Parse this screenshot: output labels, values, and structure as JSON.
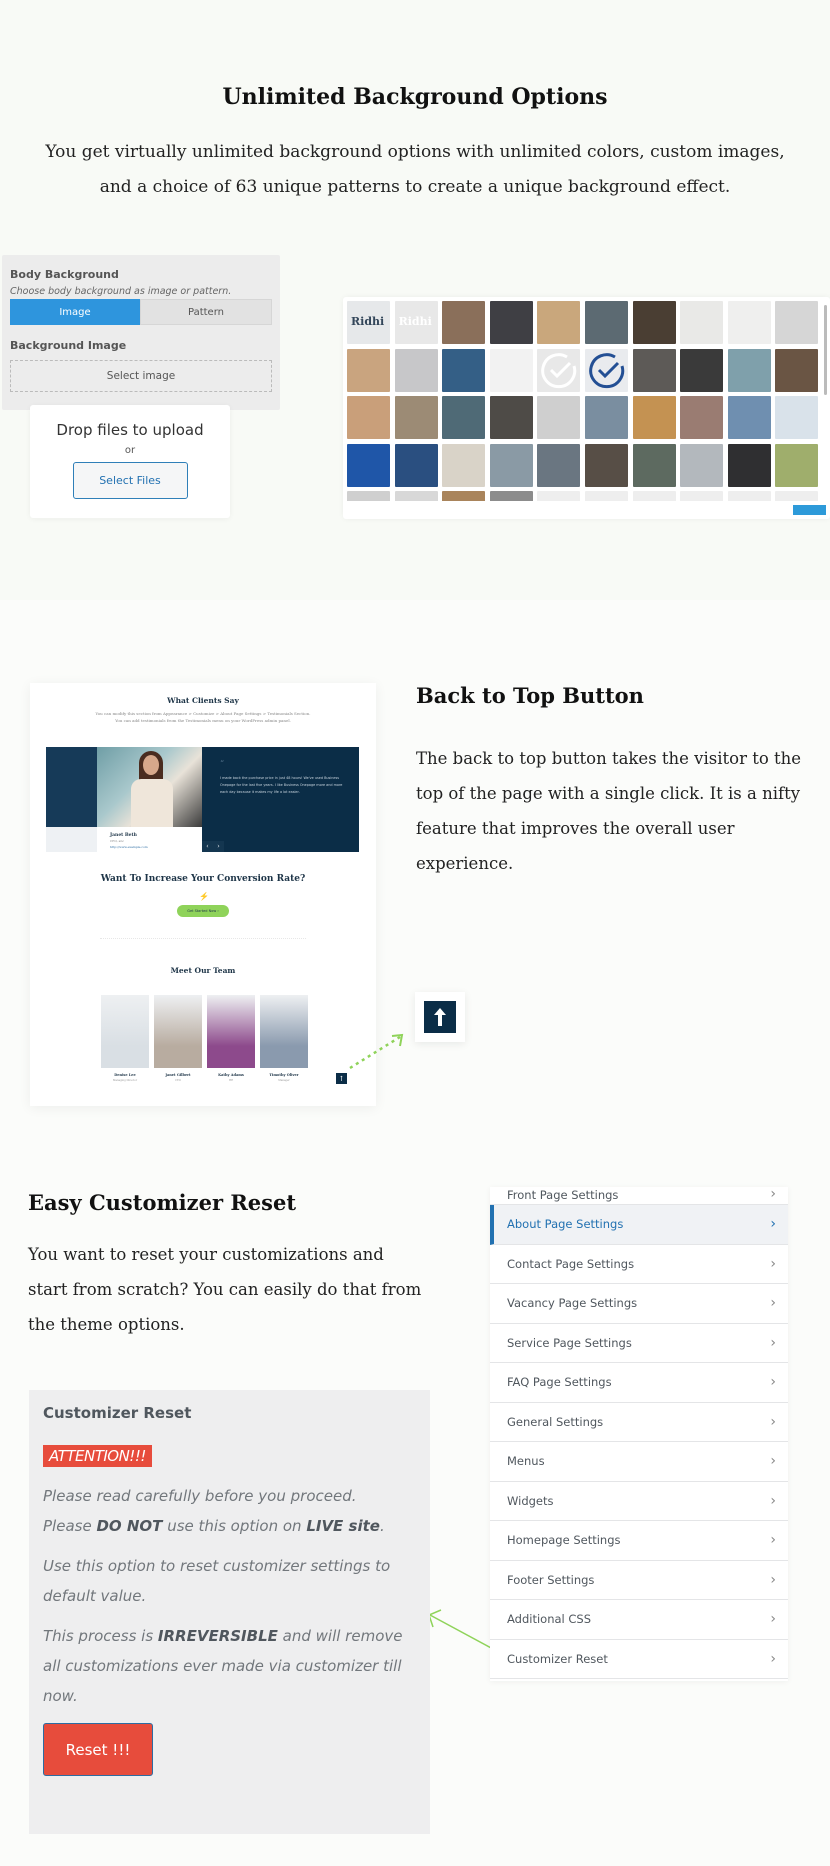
{
  "background_section": {
    "title": "Unlimited Background Options",
    "description": "You get virtually unlimited background options with unlimited colors, custom images, and a choice of 63 unique patterns to create a unique background effect.",
    "body_background": {
      "label": "Body Background",
      "hint": "Choose body background as image or pattern.",
      "options": [
        "Image",
        "Pattern"
      ],
      "selected": "Image",
      "bg_image_label": "Background Image",
      "select_image": "Select image"
    },
    "upload": {
      "title": "Drop files to upload",
      "or": "or",
      "button": "Select Files"
    },
    "image_grid": {
      "thumbnails": [
        {
          "label": "Ridhi",
          "color": "#e6e8ea",
          "text_color": "#33465a"
        },
        {
          "label": "Ridhi",
          "color": "#e8e8e8",
          "text_color": "#ffffff"
        },
        {
          "color": "#8a6f5a"
        },
        {
          "color": "#3f3f44"
        },
        {
          "color": "#c9a77c"
        },
        {
          "color": "#5c6a72"
        },
        {
          "color": "#4a3e33"
        },
        {
          "color": "#e9e9e7"
        },
        {
          "color": "#efefee"
        },
        {
          "color": "#d6d6d6"
        },
        {
          "color": "#c9a47f"
        },
        {
          "color": "#c7c7c9"
        },
        {
          "color": "#345f86"
        },
        {
          "color": "#f2f2f2"
        },
        {
          "icon": "check-circle-icon",
          "color": "#e8e8e8",
          "stroke": "#ffffff"
        },
        {
          "icon": "check-circle-icon",
          "color": "#e9ebee",
          "stroke": "#234f94"
        },
        {
          "color": "#5d5a57"
        },
        {
          "color": "#3a3a3a"
        },
        {
          "color": "#7fa0ab"
        },
        {
          "color": "#6a5544"
        },
        {
          "color": "#c99f7a"
        },
        {
          "color": "#9c8b75"
        },
        {
          "color": "#4f6a76"
        },
        {
          "color": "#4e4b47"
        },
        {
          "color": "#cfcfcf"
        },
        {
          "color": "#7a8ea0"
        },
        {
          "color": "#c49252"
        },
        {
          "color": "#9a7c72"
        },
        {
          "color": "#6f8fb0"
        },
        {
          "color": "#d9e2ea"
        },
        {
          "color": "#1f56a8"
        },
        {
          "color": "#2a4f80"
        },
        {
          "color": "#d9d3c8"
        },
        {
          "color": "#8a9aa5"
        },
        {
          "color": "#6a7681"
        },
        {
          "color": "#574e46"
        },
        {
          "color": "#5d6a60"
        },
        {
          "color": "#b3b8bd"
        },
        {
          "color": "#2f2f31"
        },
        {
          "color": "#9fae6c"
        },
        {
          "color": "#cfcfcf"
        },
        {
          "color": "#d8d8d8"
        },
        {
          "color": "#a9845b"
        },
        {
          "color": "#8c8c8c"
        },
        {
          "color": "#eeeeee"
        },
        {
          "color": "#eeeeee"
        },
        {
          "color": "#eeeeee"
        },
        {
          "color": "#eeeeee"
        },
        {
          "color": "#eeeeee"
        },
        {
          "color": "#eeeeee"
        }
      ]
    }
  },
  "back_to_top_section": {
    "title": "Back to Top Button",
    "description": "The back to top button takes the visitor to the top of the page with a single click. It is a nifty feature that improves the overall user experience.",
    "demo": {
      "testimonials_title": "What Clients Say",
      "testimonials_sub1": "You can modify this section from Appearance > Customize > About Page Settings > Testimonials Section.",
      "testimonials_sub2": "You can add testimonials from the Testimonials menu on your WordPress admin panel.",
      "quote_mark": "“",
      "quote_text": "I made back the purchase price in just 48 hours! We've used Business Onepage for the last five years. I like Business Onepage more and more each day because it makes my life a lot easier.",
      "person_name": "Janet Beth",
      "person_role": "CEO, abc",
      "person_url": "http://www.example.com",
      "prev": "‹",
      "next": "›",
      "cta_title": "Want To Increase Your Conversion Rate?",
      "cta_button": "Get Started Now ›",
      "team_title": "Meet Our Team",
      "team": [
        {
          "name": "Denise Lee",
          "role": "Managing Director",
          "color": "#d9dfe4"
        },
        {
          "name": "Janet Gilbert",
          "role": "CEO",
          "color": "#b8aca0"
        },
        {
          "name": "Kathy Adams",
          "role": "HR",
          "color": "#8d4a8c"
        },
        {
          "name": "Timothy Oliver",
          "role": "Manager",
          "color": "#8a9aae"
        }
      ],
      "mini_top_icon": "↑"
    },
    "button_icon": "arrow-up-icon"
  },
  "reset_section": {
    "title": "Easy Customizer Reset",
    "description": "You want to reset your customizations and start from scratch? You can easily do that from the theme options.",
    "menu": [
      {
        "label": "Front Page Settings",
        "active": false
      },
      {
        "label": "About Page Settings",
        "active": true
      },
      {
        "label": "Contact Page Settings",
        "active": false
      },
      {
        "label": "Vacancy Page Settings",
        "active": false
      },
      {
        "label": "Service Page Settings",
        "active": false
      },
      {
        "label": "FAQ Page Settings",
        "active": false
      },
      {
        "label": "General Settings",
        "active": false
      },
      {
        "label": "Menus",
        "active": false
      },
      {
        "label": "Widgets",
        "active": false
      },
      {
        "label": "Homepage Settings",
        "active": false
      },
      {
        "label": "Footer Settings",
        "active": false
      },
      {
        "label": "Additional CSS",
        "active": false
      },
      {
        "label": "Customizer Reset",
        "active": false
      }
    ],
    "panel": {
      "heading": "Customizer Reset",
      "attention": "ATTENTION!!!",
      "p1_a": "Please read carefully before you proceed.",
      "p1_b": "Please ",
      "p1_c": "DO NOT",
      "p1_d": " use this option on ",
      "p1_e": "LIVE site",
      "p1_f": ".",
      "p2": "Use this option to reset customizer settings to default value.",
      "p3_a": "This process is ",
      "p3_b": "IRREVERSIBLE",
      "p3_c": " and will remove all customizations ever made via customizer till now.",
      "button": "Reset !!!"
    }
  },
  "colors": {
    "accent_blue": "#2e95dd",
    "wp_blue": "#2271b1",
    "navy": "#0b2d47",
    "danger_red": "#e74c3c",
    "arrow_green": "#8fd35a"
  }
}
